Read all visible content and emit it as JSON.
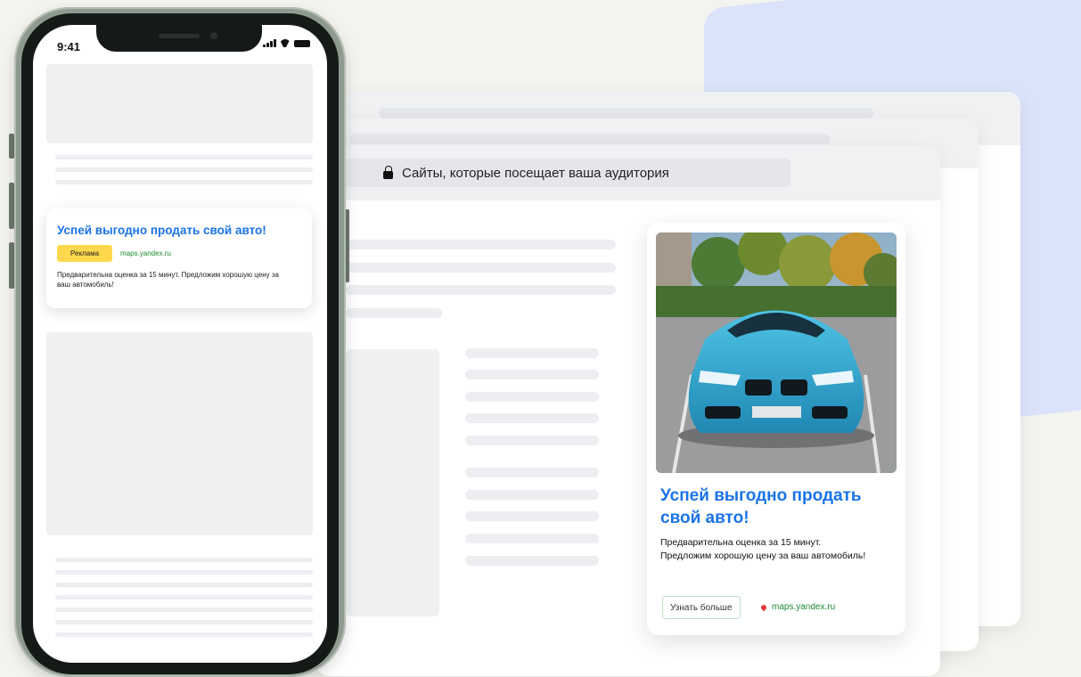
{
  "phone": {
    "status_time": "9:41"
  },
  "mobile_ad": {
    "title": "Успей выгодно продать свой авто!",
    "badge": "Реклама",
    "domain": "maps.yandex.ru",
    "description": "Предварительна оценка за 15 минут. Предложим хорошую цену за ваш автомобиль!"
  },
  "browser": {
    "address_text": "Сайты, которые посещает ваша аудитория"
  },
  "desktop_ad": {
    "title": "Успей выгодно продать свой авто!",
    "description": "Предварительна оценка за 15 минут. Предложим хорошую цену за ваш автомобиль!",
    "button_label": "Узнать больше",
    "domain": "maps.yandex.ru",
    "image": "blue-sports-car-photo"
  },
  "colors": {
    "background": "#f3f3ef",
    "accent_blue": "#1a73e8",
    "badge_yellow": "#ffd84d",
    "domain_green": "#1a8a2e",
    "back_card": "#dbe3fb"
  }
}
